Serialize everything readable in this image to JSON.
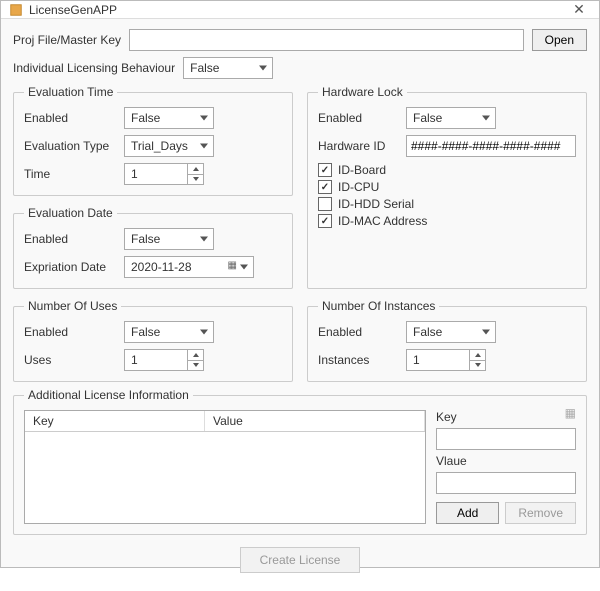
{
  "window": {
    "title": "LicenseGenAPP"
  },
  "projRow": {
    "label": "Proj File/Master Key",
    "value": "",
    "openBtn": "Open"
  },
  "indivRow": {
    "label": "Individual Licensing Behaviour",
    "value": "False"
  },
  "evalTime": {
    "legend": "Evaluation Time",
    "enabledLabel": "Enabled",
    "enabledValue": "False",
    "typeLabel": "Evaluation Type",
    "typeValue": "Trial_Days",
    "timeLabel": "Time",
    "timeValue": "1"
  },
  "hwLock": {
    "legend": "Hardware Lock",
    "enabledLabel": "Enabled",
    "enabledValue": "False",
    "hwIdLabel": "Hardware ID",
    "hwIdValue": "####-####-####-####-####",
    "cbBoard": "ID-Board",
    "cbCpu": "ID-CPU",
    "cbHdd": "ID-HDD Serial",
    "cbMac": "ID-MAC Address"
  },
  "evalDate": {
    "legend": "Evaluation Date",
    "enabledLabel": "Enabled",
    "enabledValue": "False",
    "exprLabel": "Expriation Date",
    "exprValue": "2020-11-28"
  },
  "uses": {
    "legend": "Number Of Uses",
    "enabledLabel": "Enabled",
    "enabledValue": "False",
    "usesLabel": "Uses",
    "usesValue": "1"
  },
  "instances": {
    "legend": "Number Of Instances",
    "enabledLabel": "Enabled",
    "enabledValue": "False",
    "instLabel": "Instances",
    "instValue": "1"
  },
  "addInfo": {
    "legend": "Additional License Information",
    "colKey": "Key",
    "colValue": "Value",
    "keyLabel": "Key",
    "valueLabel": "Vlaue",
    "addBtn": "Add",
    "removeBtn": "Remove"
  },
  "footer": {
    "createBtn": "Create License"
  }
}
